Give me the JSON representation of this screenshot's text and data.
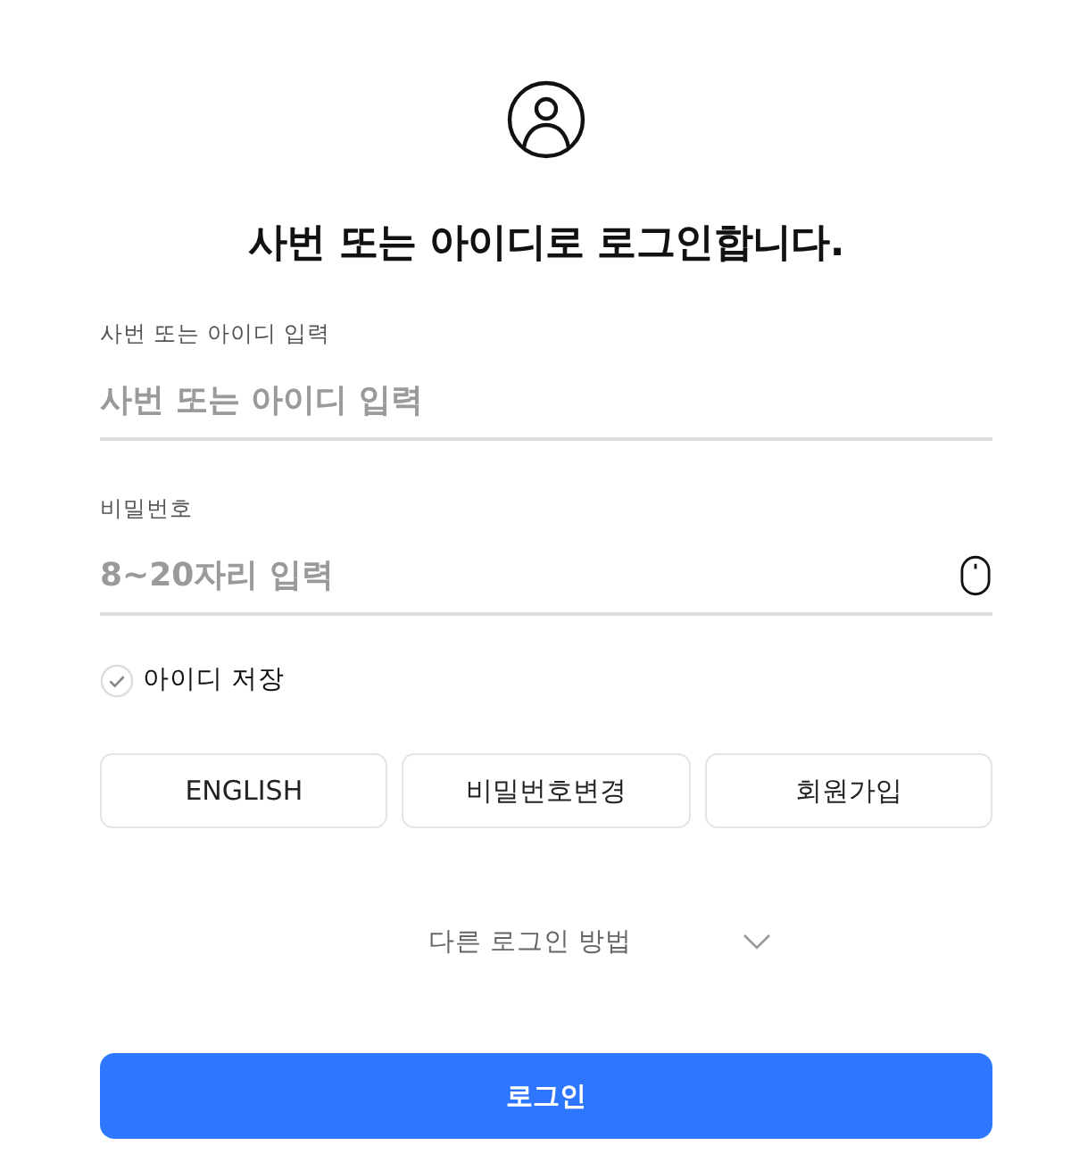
{
  "header": {
    "title": "사번 또는 아이디로 로그인합니다."
  },
  "fields": [
    {
      "kind": "text",
      "label": "사번 또는 아이디 입력",
      "placeholder": "사번 또는 아이디 입력"
    },
    {
      "kind": "password",
      "label": "비밀번호",
      "placeholder": "8~20자리 입력"
    }
  ],
  "remember_id": {
    "label": "아이디 저장",
    "checked": false
  },
  "links": [
    "ENGLISH",
    "비밀번호변경",
    "회원가입"
  ],
  "other_login": {
    "label": "다른 로그인 방법",
    "expanded": false
  },
  "login_button": {
    "label": "로그인"
  }
}
